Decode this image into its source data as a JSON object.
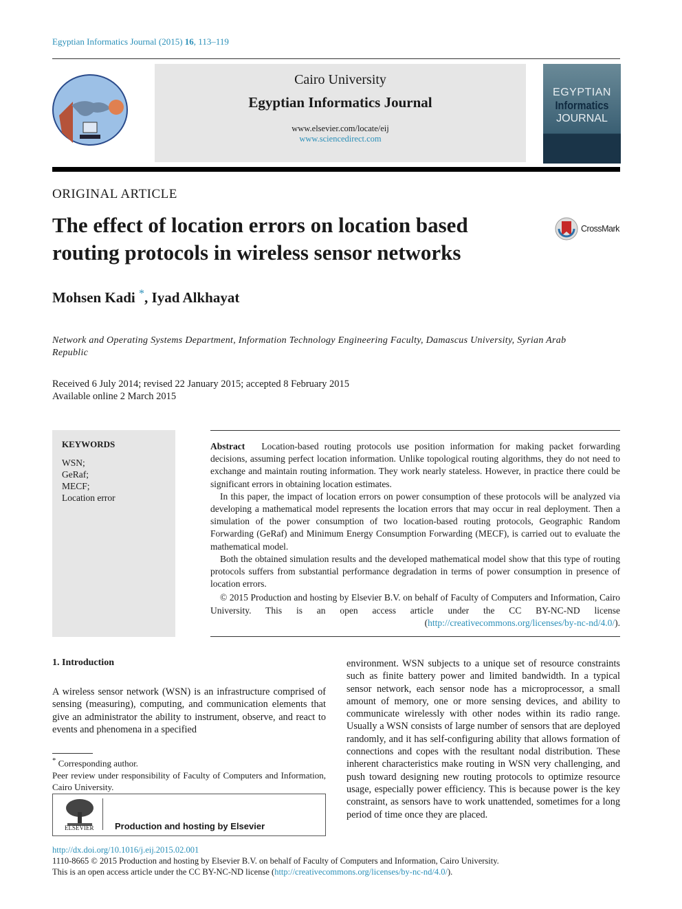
{
  "header": {
    "journal_ref_prefix": "Egyptian Informatics Journal (2015) ",
    "journal_ref_volume": "16",
    "journal_ref_pages": ", 113–119",
    "university": "Cairo University",
    "journal_name": "Egyptian Informatics Journal",
    "url1": "www.elsevier.com/locate/eij",
    "url2": "www.sciencedirect.com",
    "cover": {
      "line1": "EGYPTIAN",
      "line2": "Informatics",
      "line3": "JOURNAL"
    }
  },
  "article": {
    "section_label": "ORIGINAL ARTICLE",
    "title": "The effect of location errors on location based routing protocols in wireless sensor networks",
    "crossmark": "CrossMark",
    "author1": "Mohsen Kadi",
    "author_mark": "*",
    "author2": ", Iyad Alkhayat",
    "affiliation": "Network and Operating Systems Department, Information Technology Engineering Faculty, Damascus University, Syrian Arab Republic",
    "received": "Received 6 July 2014; revised 22 January 2015; accepted 8 February 2015",
    "available": "Available online 2 March 2015"
  },
  "keywords": {
    "heading": "KEYWORDS",
    "items": [
      "WSN;",
      "GeRaf;",
      "MECF;",
      "Location error"
    ]
  },
  "abstract": {
    "label": "Abstract",
    "p1": "Location-based routing protocols use position information for making packet forwarding decisions, assuming perfect location information. Unlike topological routing algorithms, they do not need to exchange and maintain routing information. They work nearly stateless. However, in practice there could be significant errors in obtaining location estimates.",
    "p2": "In this paper, the impact of location errors on power consumption of these protocols will be analyzed via developing a mathematical model represents the location errors that may occur in real deployment. Then a simulation of the power consumption of two location-based routing protocols, Geographic Random Forwarding (GeRaf) and Minimum Energy Consumption Forwarding (MECF), is carried out to evaluate the mathematical model.",
    "p3": "Both the obtained simulation results and the developed mathematical model show that this type of routing protocols suffers from substantial performance degradation in terms of power consumption in presence of location errors.",
    "license_text": "© 2015 Production and hosting by Elsevier B.V. on behalf of Faculty of Computers and Information, Cairo University. This is an open access article under the CC BY-NC-ND license (",
    "license_link": "http://creativecommons.org/licenses/by-nc-nd/4.0/",
    "license_end": ")."
  },
  "intro": {
    "heading": "1. Introduction",
    "p_left": "A wireless sensor network (WSN) is an infrastructure comprised of sensing (measuring), computing, and communication elements that give an administrator the ability to instrument, observe, and react to events and phenomena in a specified",
    "p_right": "environment. WSN subjects to a unique set of resource constraints such as finite battery power and limited bandwidth. In a typical sensor network, each sensor node has a microprocessor, a small amount of memory, one or more sensing devices, and ability to communicate wirelessly with other nodes within its radio range. Usually a WSN consists of large number of sensors that are deployed randomly, and it has self-configuring ability that allows formation of connections and copes with the resultant nodal distribution. These inherent characteristics make routing in WSN very challenging, and push toward designing new routing protocols to optimize resource usage, especially power efficiency. This is because power is the key constraint, as sensors have to work unattended, sometimes for a long period of time once they are placed."
  },
  "footnote": {
    "mark": "*",
    "corresponding": " Corresponding author.",
    "peer_review": "Peer review under responsibility of Faculty of Computers and Information, Cairo University.",
    "elsevier_wordmark": "ELSEVIER",
    "production": "Production and hosting by Elsevier"
  },
  "footer": {
    "doi": "http://dx.doi.org/10.1016/j.eij.2015.02.001",
    "issn_line": "1110-8665 © 2015 Production and hosting by Elsevier B.V. on behalf of Faculty of Computers and Information, Cairo University.",
    "oa_prefix": "This is an open access article under the CC BY-NC-ND license (",
    "oa_link": "http://creativecommons.org/licenses/by-nc-nd/4.0/",
    "oa_end": ")."
  },
  "colors": {
    "link": "#2a8fb8",
    "panel": "#e6e6e6"
  }
}
